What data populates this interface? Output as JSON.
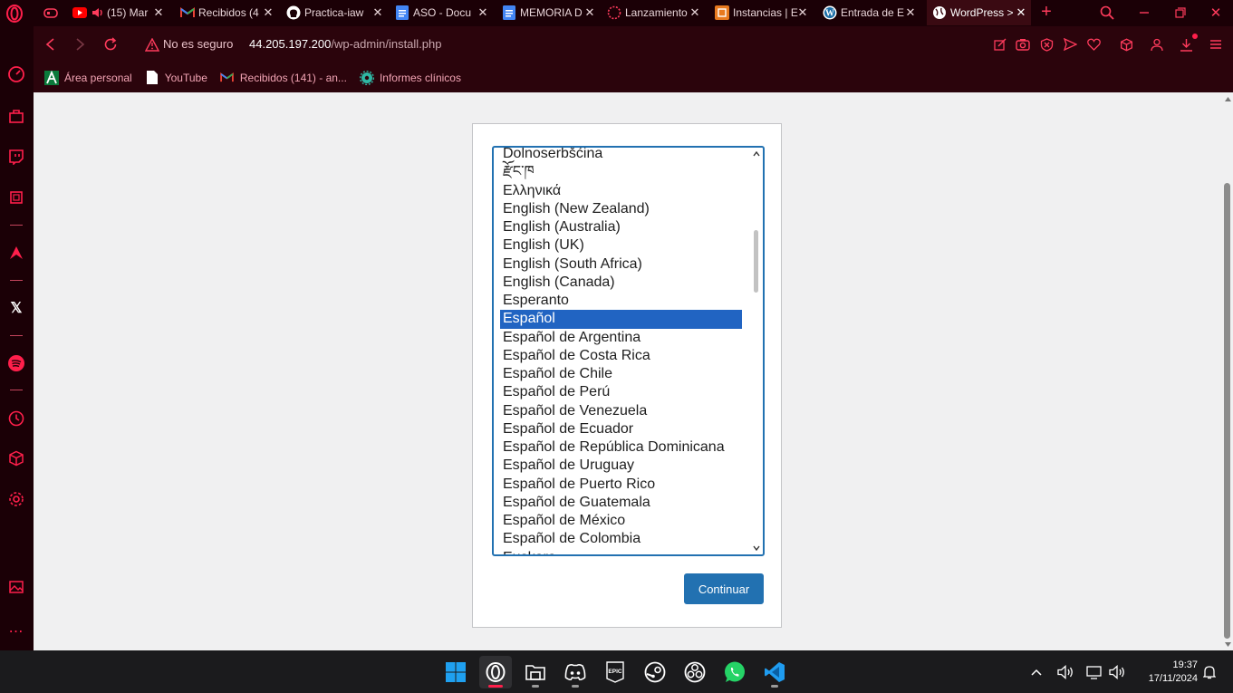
{
  "tabs": [
    {
      "title": "",
      "icon": "gamepad-icon"
    },
    {
      "title": "(15) Mar",
      "icon": "youtube-icon",
      "audio": true
    },
    {
      "title": "Recibidos (4",
      "icon": "gmail-icon"
    },
    {
      "title": "Practica-iaw",
      "icon": "github-icon"
    },
    {
      "title": "ASO - Docu",
      "icon": "docs-icon"
    },
    {
      "title": "MEMORIA D",
      "icon": "docs-icon"
    },
    {
      "title": "Lanzamiento",
      "icon": "loading-icon"
    },
    {
      "title": "Instancias | E",
      "icon": "aws-icon"
    },
    {
      "title": "Entrada de E",
      "icon": "wordpress-icon"
    },
    {
      "title": "WordPress >",
      "icon": "globe-icon",
      "active": true
    }
  ],
  "address": {
    "security_label": "No es seguro",
    "host": "44.205.197.200",
    "path": "/wp-admin/install.php"
  },
  "bookmarks": [
    {
      "label": "Área personal",
      "icon": "andalucia-icon"
    },
    {
      "label": "YouTube",
      "icon": "page-icon"
    },
    {
      "label": "Recibidos (141) - an...",
      "icon": "gmail-icon"
    },
    {
      "label": "Informes clínicos",
      "icon": "gear-flower-icon"
    }
  ],
  "languages": [
    "Dolnoserbšćina",
    "རྫོང་ཁ",
    "Ελληνικά",
    "English (New Zealand)",
    "English (Australia)",
    "English (UK)",
    "English (South Africa)",
    "English (Canada)",
    "Esperanto",
    "Español",
    "Español de Argentina",
    "Español de Costa Rica",
    "Español de Chile",
    "Español de Perú",
    "Español de Venezuela",
    "Español de Ecuador",
    "Español de República Dominicana",
    "Español de Uruguay",
    "Español de Puerto Rico",
    "Español de Guatemala",
    "Español de México",
    "Español de Colombia",
    "Euskara"
  ],
  "selected_language": "Español",
  "continue_label": "Continuar",
  "clock": {
    "time": "19:37",
    "date": "17/11/2024"
  },
  "colors": {
    "browser_bg": "#1b0006",
    "accent": "#ff1f4b",
    "wp_blue": "#2271b1",
    "selection": "#2164c2"
  }
}
